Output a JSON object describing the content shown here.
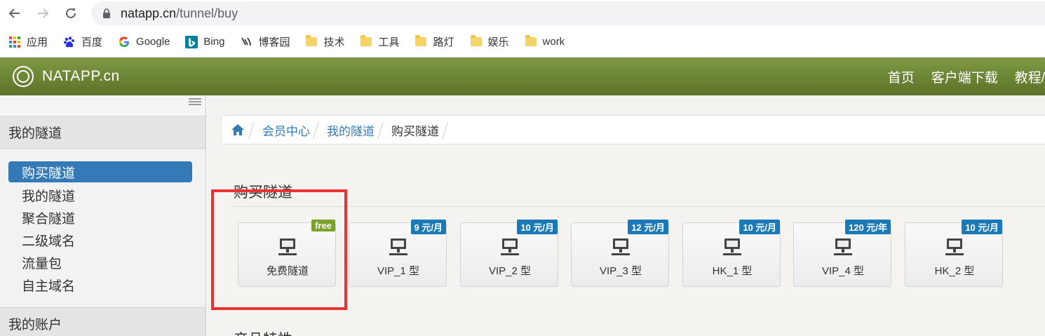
{
  "browser": {
    "url_host": "natapp.cn",
    "url_path": "/tunnel/buy",
    "bookmarks": [
      {
        "label": "应用",
        "icon": "apps-grid-icon"
      },
      {
        "label": "百度",
        "icon": "baidu-icon"
      },
      {
        "label": "Google",
        "icon": "google-icon"
      },
      {
        "label": "Bing",
        "icon": "bing-icon"
      },
      {
        "label": "博客园",
        "icon": "cnblogs-icon"
      },
      {
        "label": "技术",
        "icon": "folder-icon"
      },
      {
        "label": "工具",
        "icon": "folder-icon"
      },
      {
        "label": "路灯",
        "icon": "folder-icon"
      },
      {
        "label": "娱乐",
        "icon": "folder-icon"
      },
      {
        "label": "work",
        "icon": "folder-icon"
      }
    ]
  },
  "navbar": {
    "brand": "NATAPP.cn",
    "links": [
      "首页",
      "客户端下载",
      "教程/"
    ]
  },
  "sidebar": {
    "section1": "我的隧道",
    "items": [
      {
        "label": "购买隧道",
        "active": true
      },
      {
        "label": "我的隧道",
        "active": false
      },
      {
        "label": "聚合隧道",
        "active": false
      },
      {
        "label": "二级域名",
        "active": false
      },
      {
        "label": "流量包",
        "active": false
      },
      {
        "label": "自主域名",
        "active": false
      }
    ],
    "section2": "我的账户"
  },
  "breadcrumb": {
    "home_icon": "home-icon",
    "items": [
      "会员中心",
      "我的隧道"
    ],
    "current": "购买隧道"
  },
  "main": {
    "title": "购买隧道",
    "tiles": [
      {
        "label": "免费隧道",
        "badge": "free",
        "badge_type": "free"
      },
      {
        "label": "VIP_1 型",
        "badge": "9 元/月",
        "badge_type": "price"
      },
      {
        "label": "VIP_2 型",
        "badge": "10 元/月",
        "badge_type": "price"
      },
      {
        "label": "VIP_3 型",
        "badge": "12 元/月",
        "badge_type": "price"
      },
      {
        "label": "HK_1 型",
        "badge": "10 元/月",
        "badge_type": "price"
      },
      {
        "label": "VIP_4 型",
        "badge": "120 元/年",
        "badge_type": "price"
      },
      {
        "label": "HK_2 型",
        "badge": "10 元/月",
        "badge_type": "price"
      }
    ],
    "next_heading": "产品特性"
  },
  "colors": {
    "navbar": "#6d8737",
    "active_item": "#337ab7",
    "badge_free": "#7aa12a",
    "badge_price": "#1a79b6",
    "highlight": "#ea3233"
  }
}
